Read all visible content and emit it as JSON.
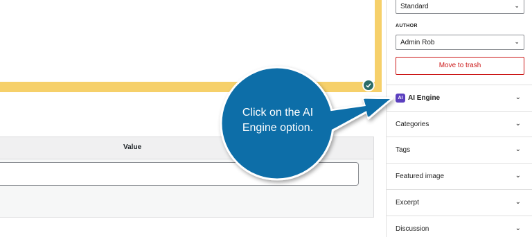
{
  "sidebar": {
    "post_format": {
      "value": "Standard"
    },
    "author": {
      "label": "AUTHOR",
      "value": "Admin Rob"
    },
    "trash_label": "Move to trash",
    "panels": [
      {
        "label": "AI Engine",
        "icon": "ai-engine-icon",
        "badge": "AI"
      },
      {
        "label": "Categories"
      },
      {
        "label": "Tags"
      },
      {
        "label": "Featured image"
      },
      {
        "label": "Excerpt"
      },
      {
        "label": "Discussion"
      }
    ]
  },
  "custom_fields": {
    "value_header": "Value",
    "value_input": ""
  },
  "callout": {
    "text": "Click on the AI Engine option."
  },
  "colors": {
    "highlight": "#f6d06a",
    "callout": "#0b6ea8",
    "danger": "#cc1818",
    "ai_icon": "#5b3fbf"
  }
}
